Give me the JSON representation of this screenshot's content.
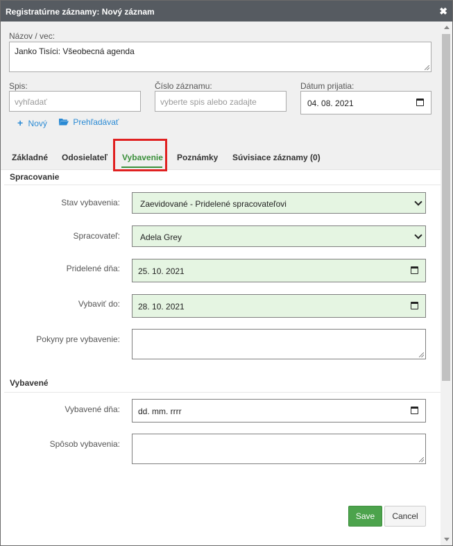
{
  "dialog": {
    "title": "Registratúrne záznamy: Nový záznam",
    "close_symbol": "✖"
  },
  "top": {
    "nazov_label": "Názov / vec:",
    "nazov_value": "Janko Tisíci: Všeobecná agenda",
    "spis_label": "Spis:",
    "spis_placeholder": "vyhľadať",
    "cislo_label": "Číslo záznamu:",
    "cislo_placeholder": "vyberte spis alebo zadajte",
    "datum_label": "Dátum prijatia:",
    "datum_value": "04. 08. 2021",
    "novy_label": "Nový",
    "novy_icon": "+",
    "prehladavat_label": "Prehľadávať",
    "folder_icon": "folder-open-icon"
  },
  "tabs": [
    {
      "label": "Základné"
    },
    {
      "label": "Odosielateľ"
    },
    {
      "label": "Vybavenie",
      "active": true
    },
    {
      "label": "Poznámky"
    },
    {
      "label": "Súvisiace záznamy (0)"
    }
  ],
  "spracovanie": {
    "title": "Spracovanie",
    "stav_label": "Stav vybavenia:",
    "stav_value": "Zaevidované - Pridelené spracovateľovi",
    "spracovatel_label": "Spracovateľ:",
    "spracovatel_value": "Adela Grey",
    "pridelene_label": "Pridelené dňa:",
    "pridelene_value": "25. 10. 2021",
    "vybavit_label": "Vybaviť do:",
    "vybavit_value": "28. 10. 2021",
    "pokyny_label": "Pokyny pre vybavenie:"
  },
  "vybavene": {
    "title": "Vybavené",
    "dna_label": "Vybavené dňa:",
    "dna_value": "dd. mm. rrrr",
    "sposob_label": "Spôsob vybavenia:"
  },
  "buttons": {
    "save": "Save",
    "cancel": "Cancel"
  },
  "colors": {
    "titlebar": "#565b61",
    "active_tab": "#3a8f3a",
    "highlight": "#e02020",
    "field_green": "#e5f5e2",
    "save": "#4ca34c",
    "link": "#2a8ad4"
  }
}
